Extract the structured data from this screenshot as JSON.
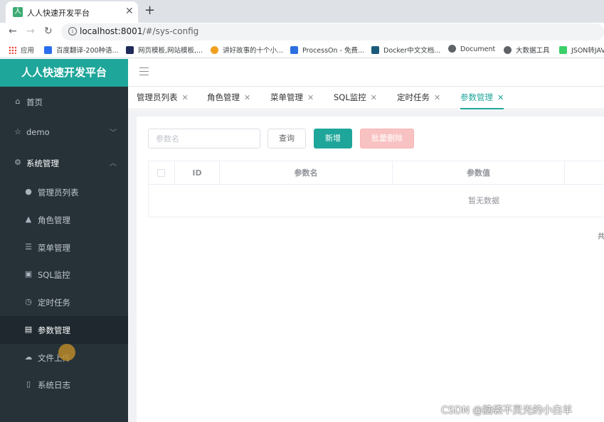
{
  "browser": {
    "tab_title": "人人快速开发平台",
    "tab_favicon_glyph": "人",
    "url_host": "localhost:8001",
    "url_path": "/#/sys-config",
    "bookmarks": [
      {
        "label": "应用",
        "color": "#e94235"
      },
      {
        "label": "百度翻译-200种语...",
        "color": "#2c6ded"
      },
      {
        "label": "网页模板,网站模板,...",
        "color": "#1e2a5a"
      },
      {
        "label": "讲好故事的十个小...",
        "color": "#f0a020"
      },
      {
        "label": "ProcessOn - 免费...",
        "color": "#2b6fe0"
      },
      {
        "label": "Docker中文文档...",
        "color": "#1c5a7a"
      },
      {
        "label": "Document",
        "color": "#5f6368"
      },
      {
        "label": "大数据工具",
        "color": "#5f6368"
      },
      {
        "label": "JSON转JAV",
        "color": "#3ccf6a"
      }
    ]
  },
  "app": {
    "brand": "人人快速开发平台",
    "accent_color": "#1fa69a"
  },
  "sidebar": {
    "items": [
      {
        "label": "首页",
        "icon": "home-icon"
      },
      {
        "label": "demo",
        "icon": "star-icon"
      },
      {
        "label": "系统管理",
        "icon": "gear-icon"
      }
    ],
    "sub_items": [
      {
        "label": "管理员列表",
        "icon": "user-icon"
      },
      {
        "label": "角色管理",
        "icon": "role-icon"
      },
      {
        "label": "菜单管理",
        "icon": "list-icon"
      },
      {
        "label": "SQL监控",
        "icon": "monitor-icon"
      },
      {
        "label": "定时任务",
        "icon": "clock-icon"
      },
      {
        "label": "参数管理",
        "icon": "config-icon"
      },
      {
        "label": "文件上传",
        "icon": "upload-icon"
      },
      {
        "label": "系统日志",
        "icon": "log-icon"
      }
    ]
  },
  "page_tabs": [
    {
      "label": "管理员列表"
    },
    {
      "label": "角色管理"
    },
    {
      "label": "菜单管理"
    },
    {
      "label": "SQL监控"
    },
    {
      "label": "定时任务"
    },
    {
      "label": "参数管理"
    }
  ],
  "toolbar": {
    "search_placeholder": "参数名",
    "query_label": "查询",
    "add_label": "新增",
    "batch_delete_label": "批量删除"
  },
  "table": {
    "columns": [
      "ID",
      "参数名",
      "参数值"
    ],
    "empty_text": "暂无数据"
  },
  "footer": {
    "total_prefix": "共"
  },
  "watermark": "CSDN @脑袋不灵光的小白羊"
}
